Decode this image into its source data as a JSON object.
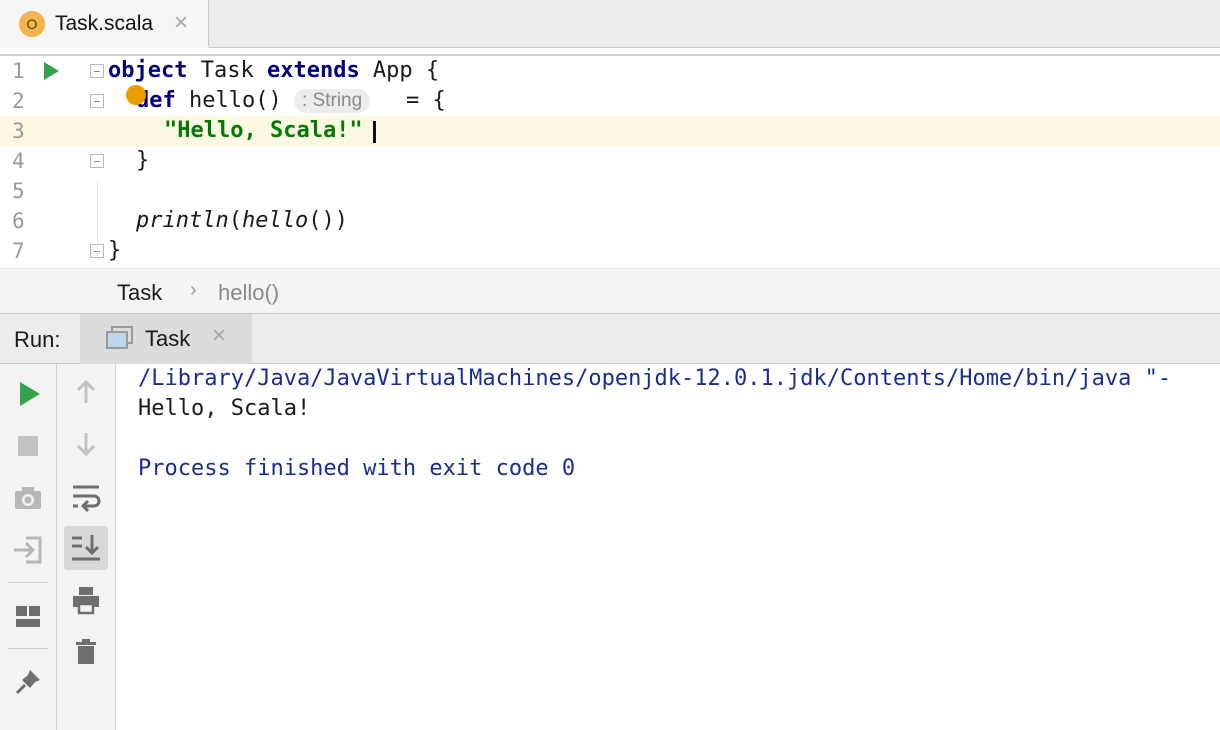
{
  "editor_tab": {
    "icon_letter": "O",
    "title": "Task.scala",
    "close_glyph": "×"
  },
  "code": {
    "line_numbers": [
      "1",
      "2",
      "3",
      "4",
      "5",
      "6",
      "7"
    ],
    "l1_kw1": "object",
    "l1_name": " Task ",
    "l1_kw2": "extends",
    "l1_rest": " App {",
    "l2_kw": "def",
    "l2_fn": " hello()",
    "l2_hint": ": String",
    "l2_rest": "= {",
    "l3_str": "\"Hello, Scala!\"",
    "l4": "}",
    "l6_fn": "println",
    "l6_open": "(",
    "l6_arg": "hello",
    "l6_close": "())",
    "l7": "}"
  },
  "breadcrumb": {
    "items": [
      "Task",
      "hello()"
    ],
    "separator": "›"
  },
  "run_panel": {
    "label": "Run:",
    "tab_title": "Task",
    "close_glyph": "×"
  },
  "console": {
    "command": "/Library/Java/JavaVirtualMachines/openjdk-12.0.1.jdk/Contents/Home/bin/java \"-",
    "output": "Hello, Scala!",
    "status": "Process finished with exit code 0"
  },
  "toolbar_left_icons": [
    "rerun-icon",
    "stop-icon",
    "camera-icon",
    "login-icon",
    "layout-icon",
    "pin-icon"
  ],
  "toolbar_right_icons": [
    "arrow-up-icon",
    "arrow-down-icon",
    "soft-wrap-icon",
    "scroll-to-end-icon",
    "print-icon",
    "trash-icon"
  ],
  "colors": {
    "keyword": "#000080",
    "string": "#007a00",
    "console_system": "#1a2d8f",
    "run_green": "#35a24e",
    "current_line": "#fcf8e2",
    "bulb": "#ee9b00"
  }
}
